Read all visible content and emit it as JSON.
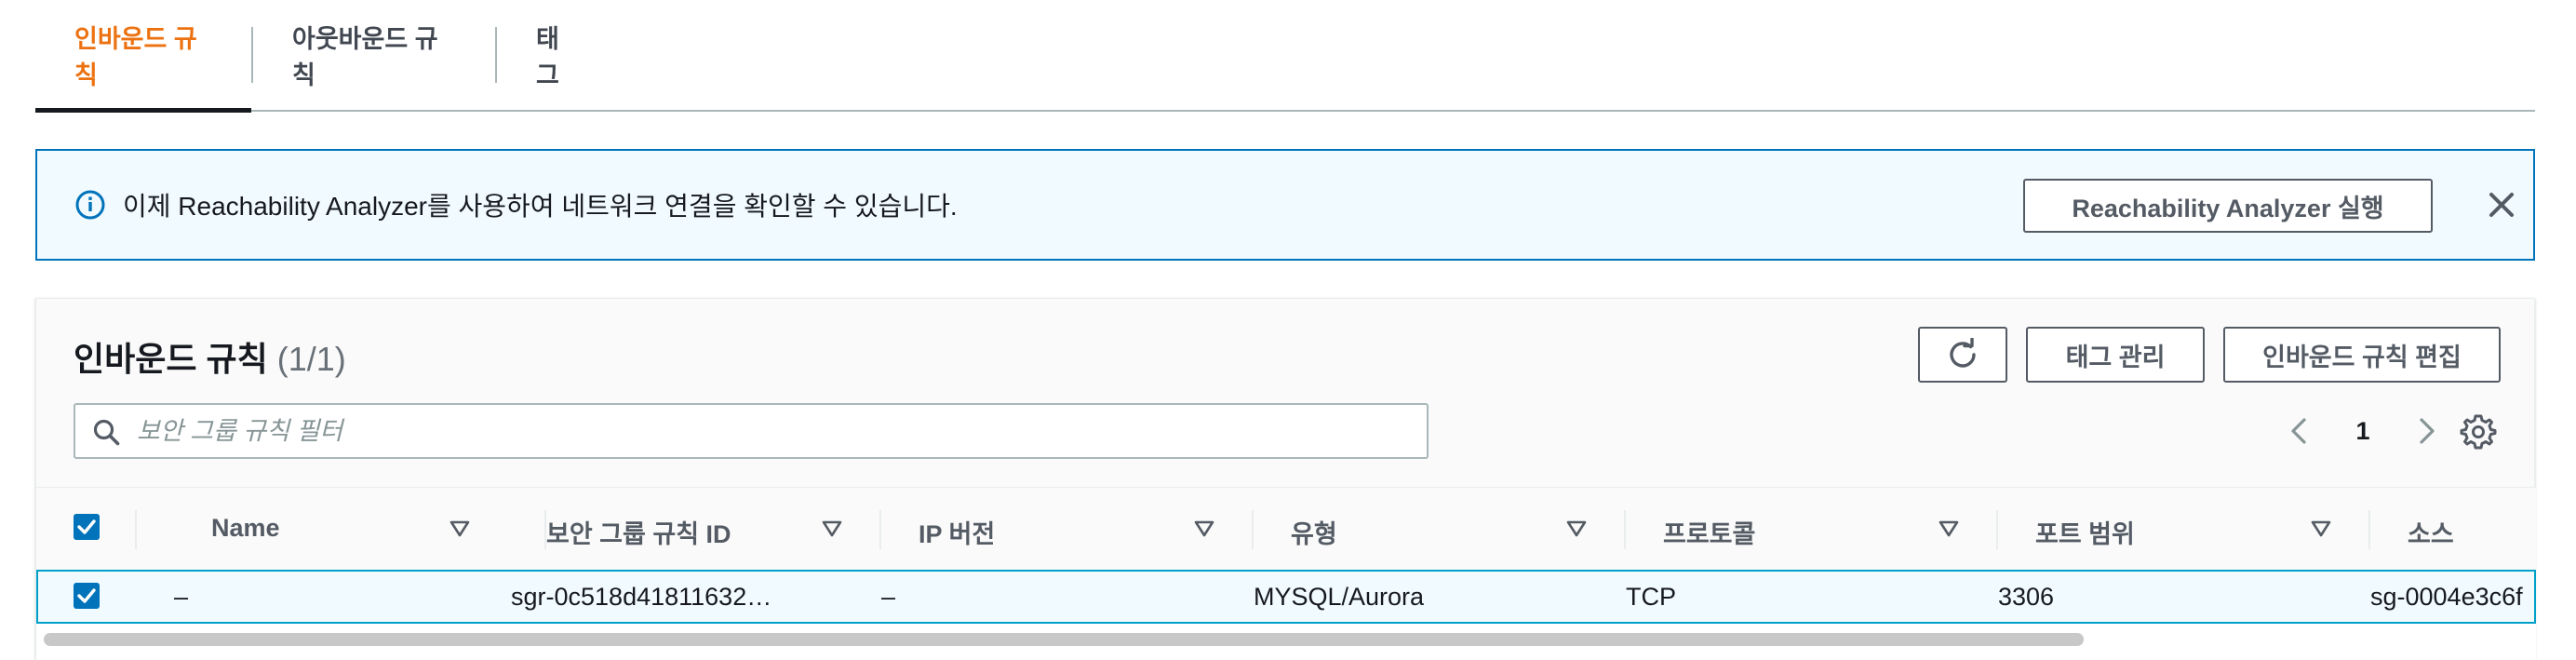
{
  "tabs": [
    {
      "label": "인바운드 규칙",
      "active": true
    },
    {
      "label": "아웃바운드 규칙",
      "active": false
    },
    {
      "label": "태그",
      "active": false
    }
  ],
  "banner": {
    "message": "이제 Reachability Analyzer를 사용하여 네트워크 연결을 확인할 수 있습니다.",
    "button_label": "Reachability Analyzer 실행",
    "icon": "info-icon"
  },
  "panel": {
    "title": "인바운드 규칙",
    "count": "(1/1)",
    "manage_tags_label": "태그 관리",
    "edit_rules_label": "인바운드 규칙 편집"
  },
  "filter": {
    "placeholder": "보안 그룹 규칙 필터",
    "value": ""
  },
  "pagination": {
    "current_page": "1"
  },
  "table": {
    "columns": [
      "Name",
      "보안 그룹 규칙 ID",
      "IP 버전",
      "유형",
      "프로토콜",
      "포트 범위",
      "소스"
    ],
    "rows": [
      {
        "selected": true,
        "name": "–",
        "rule_id": "sgr-0c518d41811632…",
        "ip_version": "–",
        "type": "MYSQL/Aurora",
        "protocol": "TCP",
        "port_range": "3306",
        "source": "sg-0004e3c6f"
      }
    ]
  },
  "colors": {
    "accent_orange": "#ec7211",
    "primary_blue": "#0073bb",
    "banner_bg": "#f1faff",
    "selected_row_border": "#00a1c9"
  }
}
